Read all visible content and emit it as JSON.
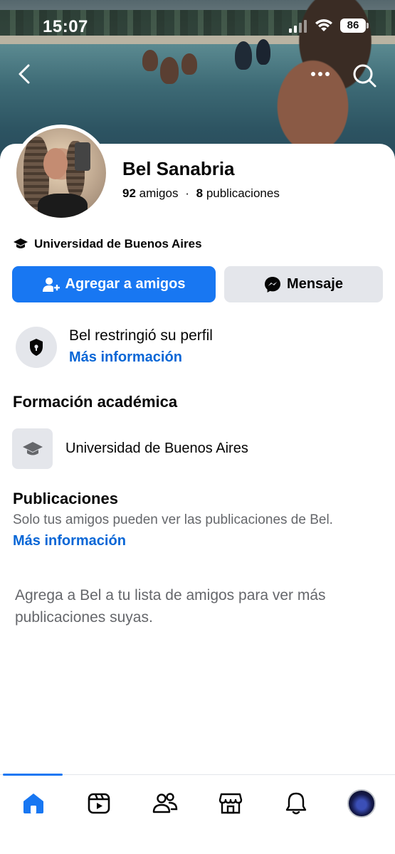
{
  "status_bar": {
    "time": "15:07",
    "battery": "86"
  },
  "profile": {
    "name": "Bel Sanabria",
    "friends_count": "92",
    "friends_label": "amigos",
    "separator": "·",
    "posts_count": "8",
    "posts_label": "publicaciones",
    "education_summary": "Universidad de Buenos Aires"
  },
  "actions": {
    "add_friend_label": "Agregar a amigos",
    "message_label": "Mensaje"
  },
  "restricted": {
    "title": "Bel restringió su perfil",
    "link": "Más información"
  },
  "education": {
    "heading": "Formación académica",
    "school": "Universidad de Buenos Aires"
  },
  "posts": {
    "heading": "Publicaciones",
    "subtitle": "Solo tus amigos pueden ver las publicaciones de Bel.",
    "link": "Más información",
    "empty_message": "Agrega a Bel a tu lista de amigos para ver más publicaciones suyas."
  },
  "tabbar": {
    "items": [
      "home-icon",
      "video-icon",
      "friends-icon",
      "marketplace-icon",
      "notifications-icon",
      "profile-avatar"
    ],
    "active": "home-icon"
  },
  "colors": {
    "accent": "#1877f2",
    "link": "#0866d6",
    "secondary_bg": "#e4e6eb",
    "secondary_text": "#65676b"
  }
}
